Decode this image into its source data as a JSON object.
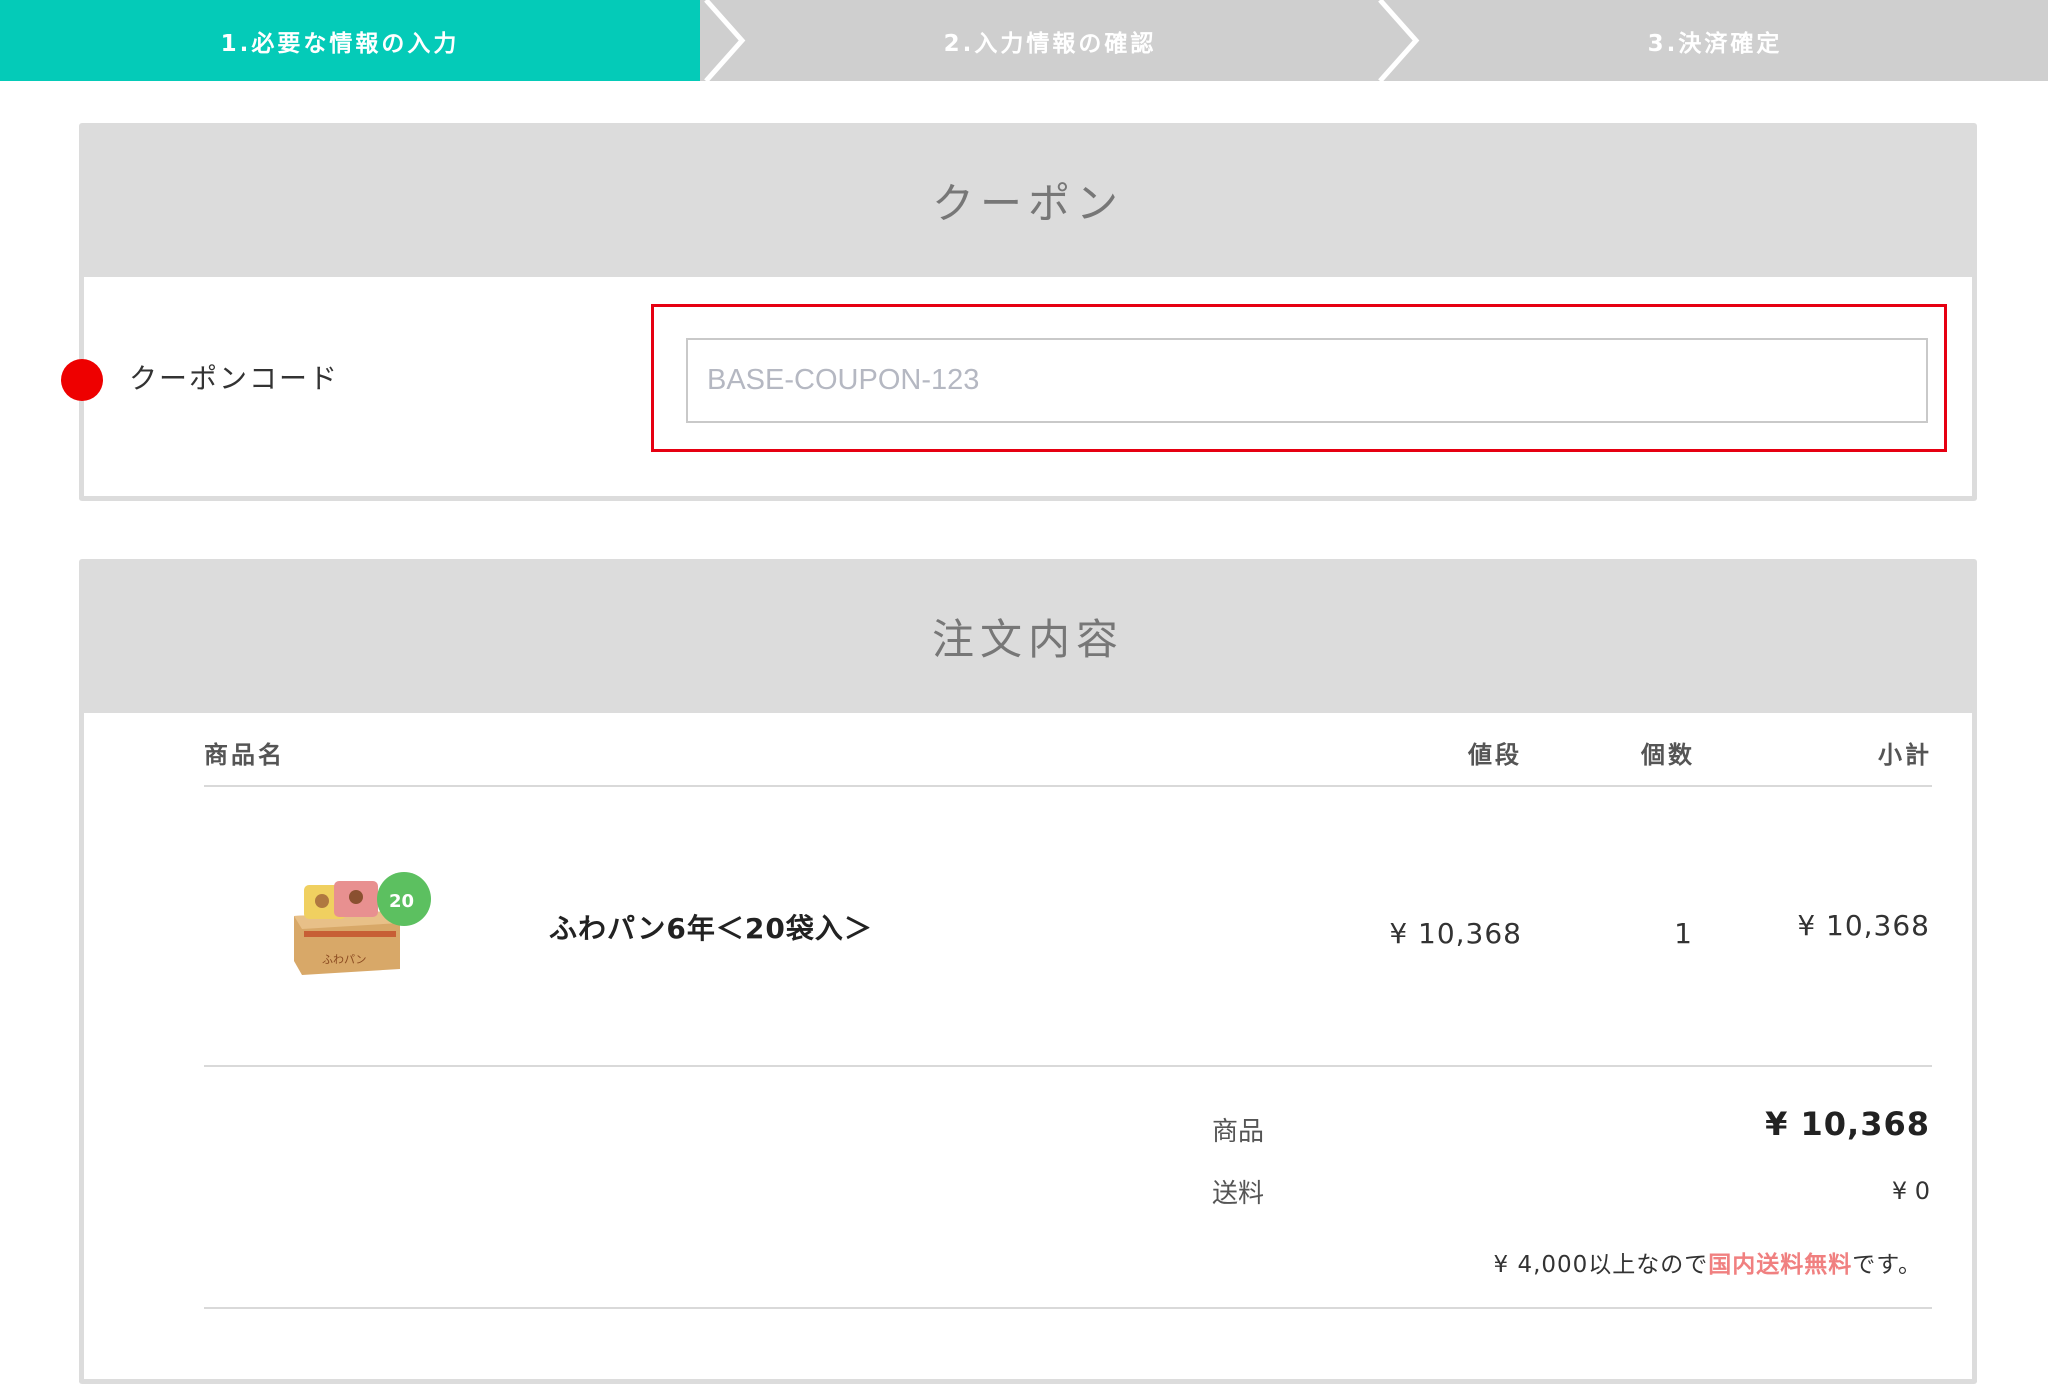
{
  "steps": [
    {
      "label": "1.必要な情報の入力",
      "active": true
    },
    {
      "label": "2.入力情報の確認",
      "active": false
    },
    {
      "label": "3.決済確定",
      "active": false
    }
  ],
  "coupon": {
    "heading": "クーポン",
    "label": "クーポンコード",
    "placeholder": "BASE-COUPON-123",
    "value": "",
    "highlight_color": "#e60012"
  },
  "order": {
    "heading": "注文内容",
    "columns": {
      "name": "商品名",
      "price": "値段",
      "qty": "個数",
      "subtotal": "小計"
    },
    "items": [
      {
        "name": "ふわパン6年＜20袋入＞",
        "price": "¥ 10,368",
        "qty": "1",
        "subtotal": "¥ 10,368",
        "thumb_badge": "20"
      }
    ],
    "summary": {
      "product_label": "商品",
      "product_total": "¥ 10,368",
      "shipping_label": "送料",
      "shipping_total": "¥ 0",
      "free_note_prefix": "¥ 4,000以上なので",
      "free_note_highlight": "国内送料無料",
      "free_note_suffix": "です。"
    }
  },
  "colors": {
    "accent": "#04cbb8",
    "required": "#ee0000",
    "step_inactive": "#cfcfcf"
  },
  "icons": {
    "required": "required-dot-icon",
    "step_separator": "chevron-right-icon"
  }
}
